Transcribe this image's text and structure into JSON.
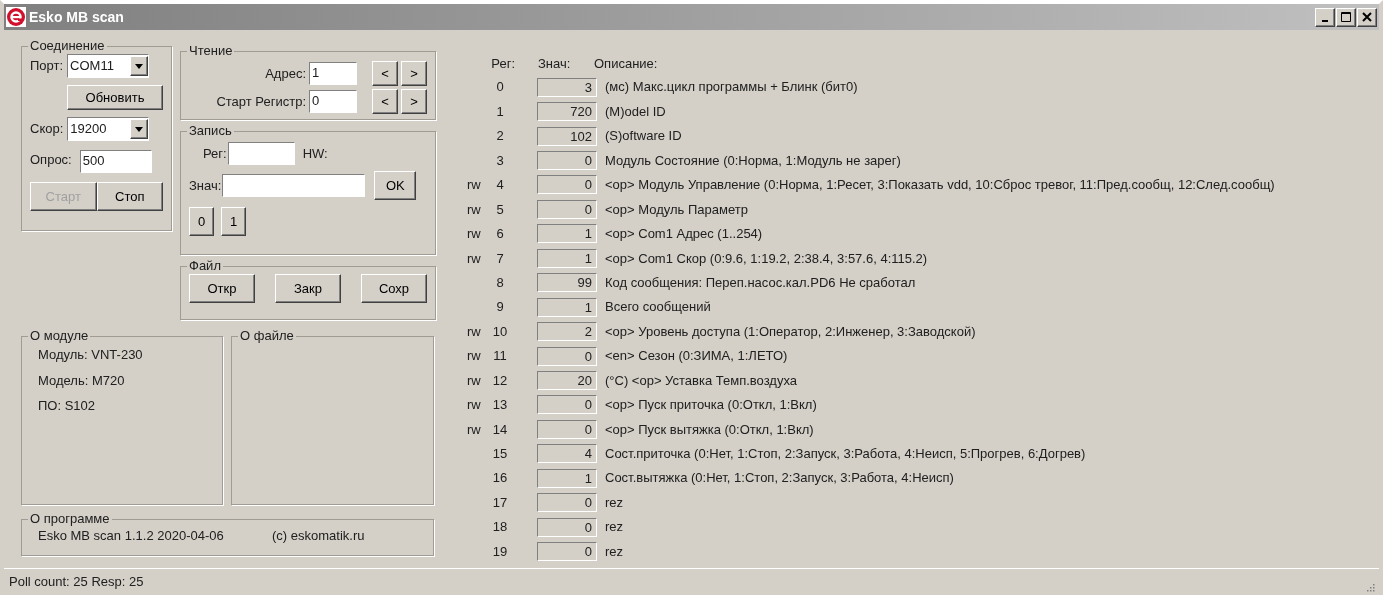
{
  "window": {
    "title": "Esko MB scan"
  },
  "connection": {
    "title": "Соединение",
    "port": {
      "label": "Порт:",
      "value": "COM11"
    },
    "refresh_button": "Обновить",
    "speed": {
      "label": "Скор:",
      "value": "19200"
    },
    "poll": {
      "label": "Опрос:",
      "value": "500"
    },
    "buttons": [
      {
        "label": "Старт",
        "disabled": true
      },
      {
        "label": "Стоп",
        "disabled": false
      }
    ]
  },
  "reading": {
    "title": "Чтение",
    "fields": [
      {
        "label": "Адрес:",
        "value": "1",
        "prev": "<",
        "next": ">"
      },
      {
        "label": "Старт Регистр:",
        "value": "0",
        "prev": "<",
        "next": ">"
      }
    ]
  },
  "writing": {
    "title": "Запись",
    "reg_label": "Рег:",
    "hw_label": "HW:",
    "value_label": "Знач:",
    "ok_button": "OK",
    "quick_buttons": [
      "0",
      "1"
    ]
  },
  "file": {
    "title": "Файл",
    "buttons": [
      "Откр",
      "Закр",
      "Сохр"
    ]
  },
  "module": {
    "title": "О модуле",
    "lines": [
      "Модуль: VNT-230",
      "Модель: M720",
      "ПО: S102"
    ]
  },
  "file_info": {
    "title": "О файле"
  },
  "about": {
    "title": "О программе",
    "version": "Esko MB scan 1.1.2 2020-04-06",
    "site": "(c) eskomatik.ru"
  },
  "registers": {
    "columns": [
      "Рег:",
      "Знач:",
      "Описание:"
    ],
    "rows": [
      {
        "reg": "0",
        "value": "3",
        "description": "(мс) Макс.цикл программы + Блинк (бит0)"
      },
      {
        "reg": "1",
        "value": "720",
        "description": "(M)odel ID"
      },
      {
        "reg": "2",
        "value": "102",
        "description": "(S)oftware ID"
      },
      {
        "reg": "3",
        "value": "0",
        "description": "Модуль Состояние (0:Норма, 1:Модуль не зарег)"
      },
      {
        "access": "rw",
        "reg": "4",
        "value": "0",
        "description": "<op> Модуль Управление (0:Норма, 1:Ресет, 3:Показать vdd, 10:Сброс тревог, 11:Пред.сообщ, 12:След.сообщ)"
      },
      {
        "access": "rw",
        "reg": "5",
        "value": "0",
        "description": "<op> Модуль Параметр"
      },
      {
        "access": "rw",
        "reg": "6",
        "value": "1",
        "description": "<op> Com1 Адрес (1..254)"
      },
      {
        "access": "rw",
        "reg": "7",
        "value": "1",
        "description": "<op> Com1 Скор (0:9.6, 1:19.2, 2:38.4, 3:57.6, 4:115.2)"
      },
      {
        "reg": "8",
        "value": "99",
        "description": "Код сообщения: Переп.насос.кал.PD6 Не сработал"
      },
      {
        "reg": "9",
        "value": "1",
        "description": "Всего сообщений"
      },
      {
        "access": "rw",
        "reg": "10",
        "value": "2",
        "description": "<op> Уровень доступа (1:Оператор, 2:Инженер, 3:Заводской)"
      },
      {
        "access": "rw",
        "reg": "11",
        "value": "0",
        "description": "<en> Сезон (0:ЗИМА, 1:ЛЕТО)"
      },
      {
        "access": "rw",
        "reg": "12",
        "value": "20",
        "description": "(°C) <op> Уставка Темп.воздуха"
      },
      {
        "access": "rw",
        "reg": "13",
        "value": "0",
        "description": "<op> Пуск приточка (0:Откл, 1:Вкл)"
      },
      {
        "access": "rw",
        "reg": "14",
        "value": "0",
        "description": "<op> Пуск вытяжка (0:Откл, 1:Вкл)"
      },
      {
        "reg": "15",
        "value": "4",
        "description": "Сост.приточка (0:Нет, 1:Стоп, 2:Запуск, 3:Работа, 4:Неисп, 5:Прогрев, 6:Догрев)"
      },
      {
        "reg": "16",
        "value": "1",
        "description": "Сост.вытяжка (0:Нет, 1:Стоп, 2:Запуск, 3:Работа, 4:Неисп)"
      },
      {
        "reg": "17",
        "value": "0",
        "description": "rez"
      },
      {
        "reg": "18",
        "value": "0",
        "description": "rez"
      },
      {
        "reg": "19",
        "value": "0",
        "description": "rez"
      }
    ]
  },
  "status_bar": {
    "text": "Poll count: 25 Resp: 25"
  }
}
